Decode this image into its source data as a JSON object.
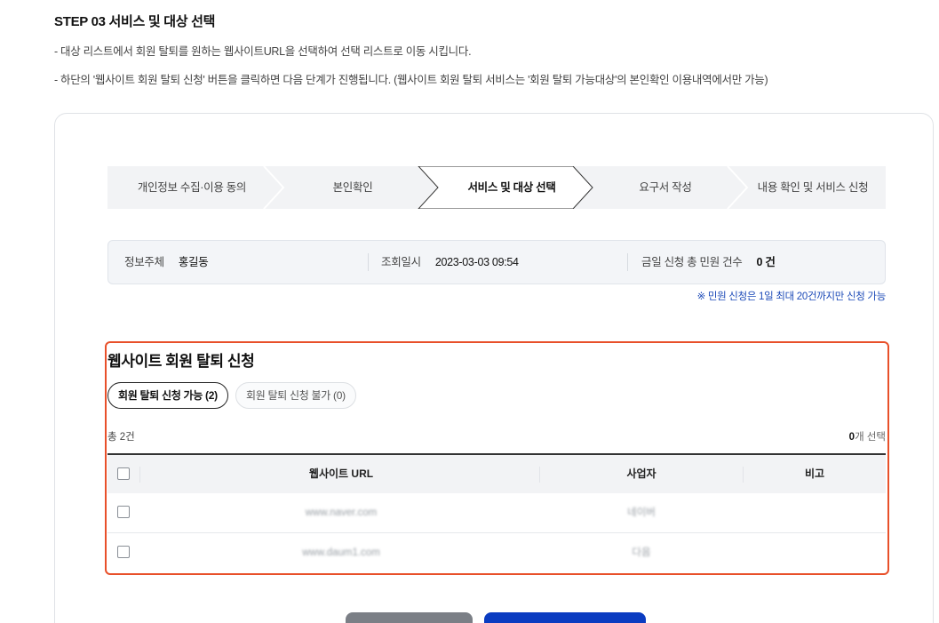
{
  "header": {
    "title": "STEP 03 서비스 및 대상 선택",
    "desc1": "- 대상 리스트에서 회원 탈퇴를 원하는 웹사이트URL을 선택하여 선택 리스트로 이동 시킵니다.",
    "desc2": "- 하단의 '웹사이트 회원 탈퇴 신청' 버튼을 클릭하면 다음 단계가 진행됩니다. (웹사이트 회원 탈퇴 서비스는 '회원 탈퇴 가능대상'의 본인확인 이용내역에서만 가능)"
  },
  "steps": [
    {
      "label": "개인정보 수집·이용 동의",
      "active": false
    },
    {
      "label": "본인확인",
      "active": false
    },
    {
      "label": "서비스 및 대상 선택",
      "active": true
    },
    {
      "label": "요구서 작성",
      "active": false
    },
    {
      "label": "내용 확인 및 서비스 신청",
      "active": false
    }
  ],
  "info": {
    "subject_label": "정보주체",
    "subject_value": "홍길동",
    "time_label": "조회일시",
    "time_value": "2023-03-03 09:54",
    "count_label": "금일 신청 총 민원 건수",
    "count_value": "0 건",
    "notice": "※ 민원 신청은 1일 최대 20건까지만 신청 가능"
  },
  "section": {
    "title": "웹사이트 회원 탈퇴 신청",
    "tab_available": "회원 탈퇴 신청 가능 (2)",
    "tab_unavailable": "회원 탈퇴 신청 불가 (0)",
    "total": "총 2건",
    "selected_count": "0",
    "selected_suffix": "개 선택"
  },
  "table": {
    "columns": [
      "웹사이트 URL",
      "사업자",
      "비고"
    ],
    "rows": [
      {
        "url": "www.naver.com",
        "company": "네이버",
        "note": ""
      },
      {
        "url": "www.daum1.com",
        "company": "다음",
        "note": ""
      }
    ]
  },
  "colors": {
    "highlight": "#e8502a",
    "primary_button": "#0b3cc1",
    "secondary_button": "#7b7f86",
    "notice_text": "#1d4bb8"
  }
}
